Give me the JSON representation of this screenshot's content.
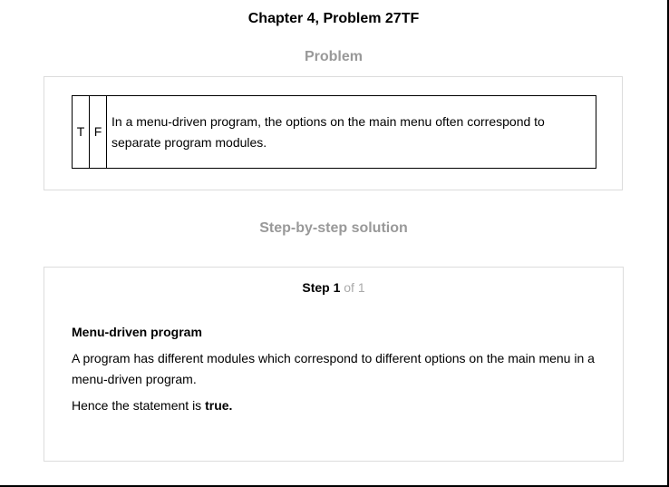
{
  "chapter_title": "Chapter 4, Problem 27TF",
  "problem": {
    "heading": "Problem",
    "true_label": "T",
    "false_label": "F",
    "question": "In a menu-driven program, the options on the main menu often correspond to separate program modules."
  },
  "solution": {
    "heading": "Step-by-step solution",
    "step_label": "Step 1",
    "step_of": "of 1",
    "subheading": "Menu-driven program",
    "paragraph": "A program has different modules which correspond to different options on the main menu in a menu-driven program.",
    "conclusion_prefix": "Hence the statement is",
    "conclusion_answer": "true."
  }
}
